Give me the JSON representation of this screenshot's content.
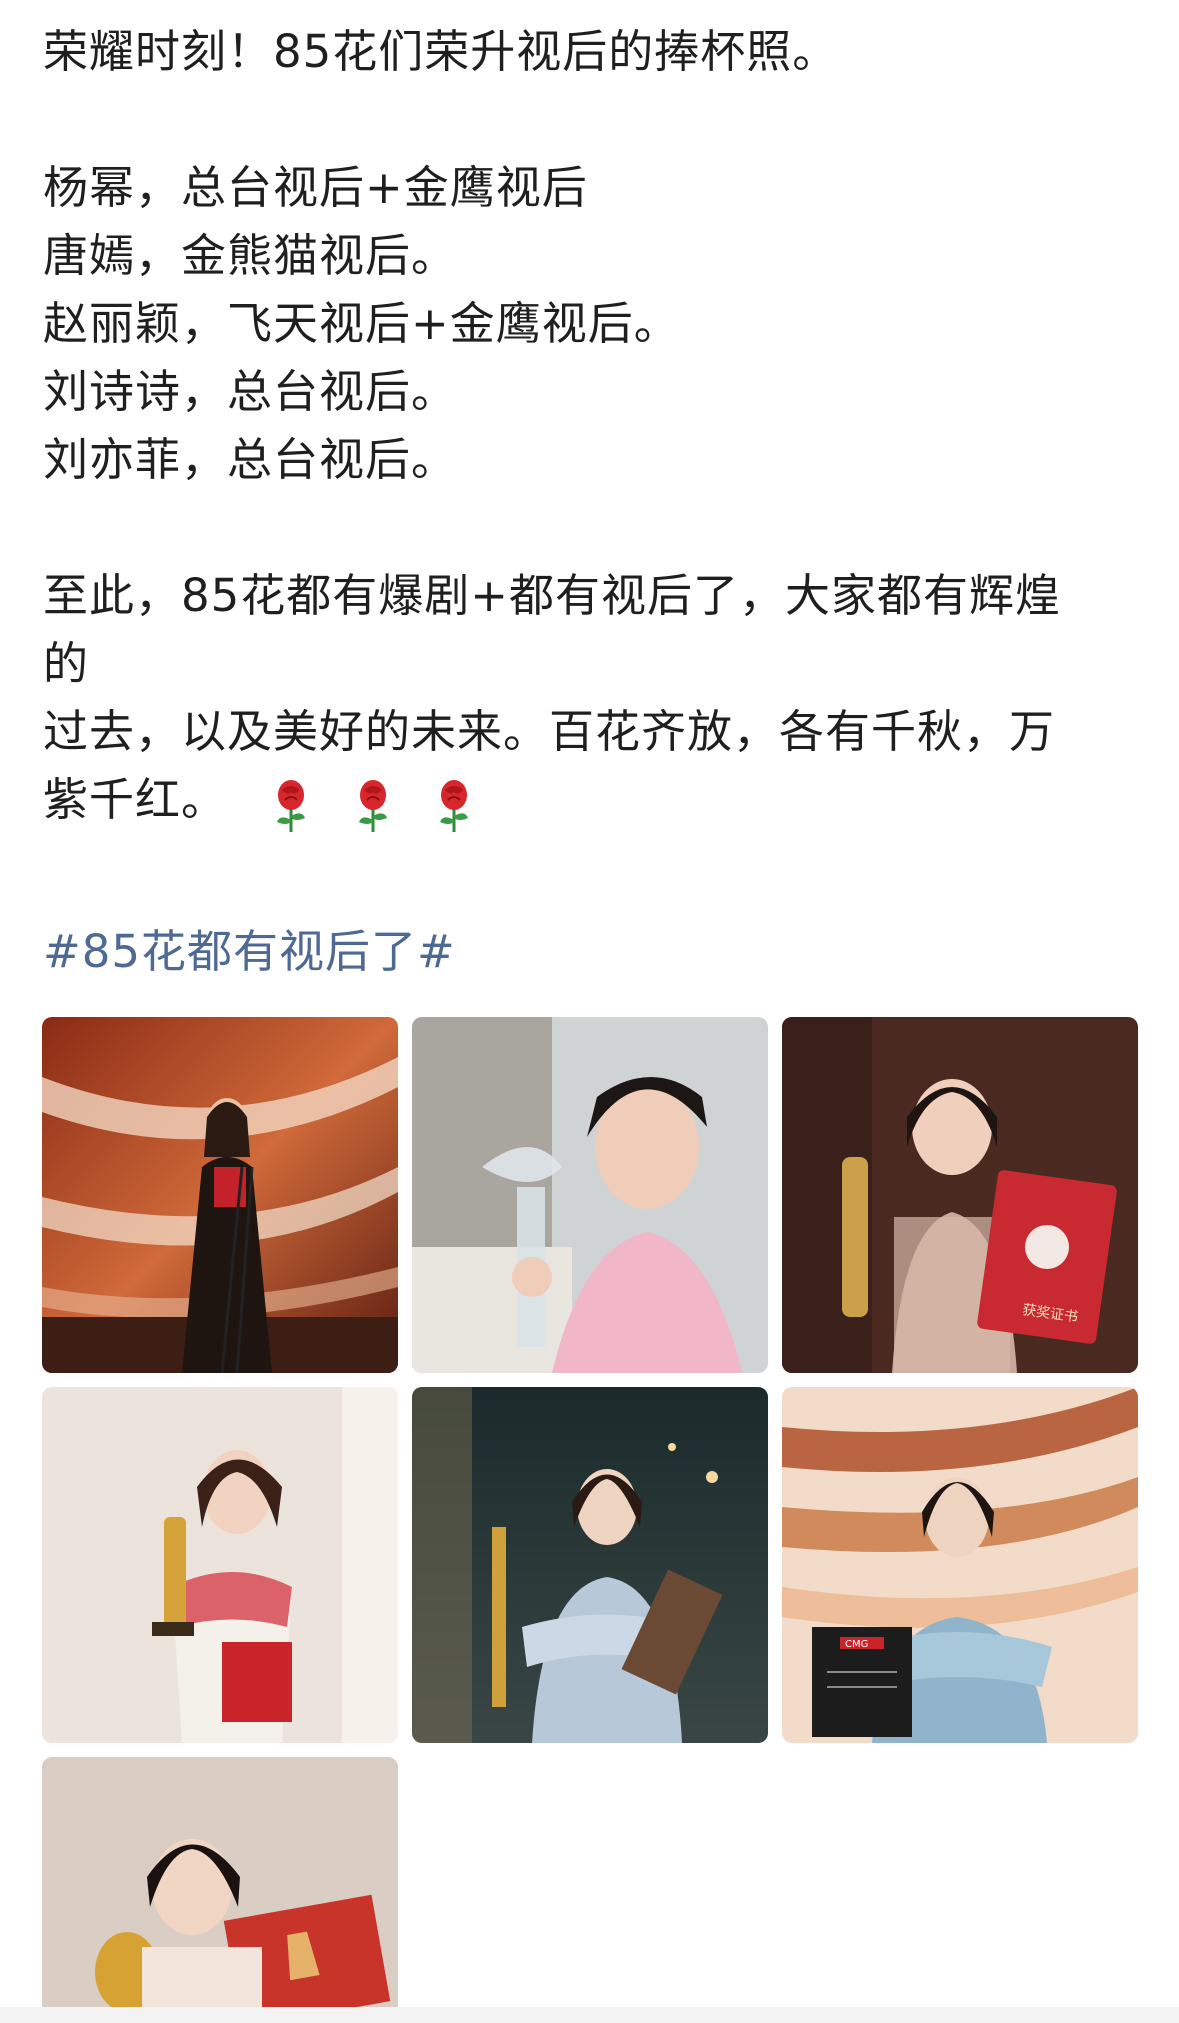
{
  "post": {
    "line1": "荣耀时刻！85花们荣升视后的捧杯照。",
    "line2": "杨幂，总台视后+金鹰视后",
    "line3": "唐嫣，金熊猫视后。",
    "line4": "赵丽颖，飞天视后+金鹰视后。",
    "line5": "刘诗诗，总台视后。",
    "line6": "刘亦菲，总台视后。",
    "line7": "至此，85花都有爆剧+都有视后了，大家都有辉煌",
    "line8": "的",
    "line9": "过去，以及美好的未来。百花齐放，各有千秋，万",
    "line10": "紫千红。",
    "emoji": [
      "rose-icon",
      "rose-icon",
      "rose-icon"
    ],
    "hashtag": "#85花都有视后了#"
  },
  "photos": [
    {
      "subject": "black-dress-speech",
      "cert_text": ""
    },
    {
      "subject": "pink-dress-crystal-trophy",
      "cert_text": ""
    },
    {
      "subject": "sequin-dress-red-certificate",
      "cert_text": "获奖证书"
    },
    {
      "subject": "white-dress-golden-statue",
      "cert_text": ""
    },
    {
      "subject": "blue-dress-stage",
      "cert_text": ""
    },
    {
      "subject": "blue-offshoulder-plaque",
      "cert_text": "CMG"
    },
    {
      "subject": "golden-trophy-red-folder",
      "cert_text": ""
    }
  ],
  "colors": {
    "text": "#1f1f1f",
    "hashtag": "#4e6a94",
    "rose": "#d7262c"
  }
}
